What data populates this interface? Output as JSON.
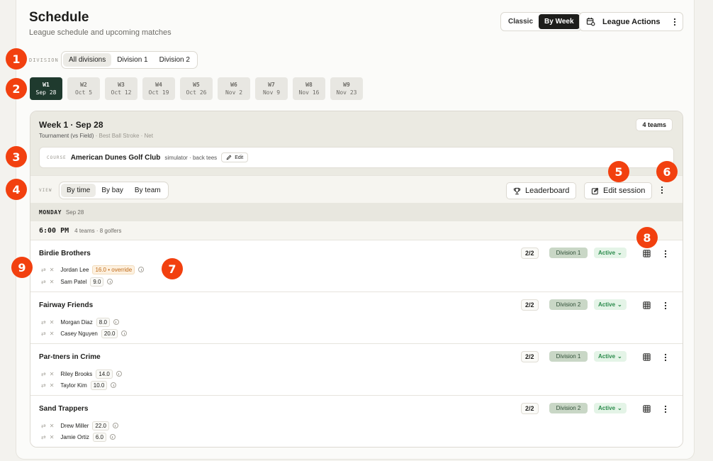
{
  "header": {
    "title": "Schedule",
    "subtitle": "League schedule and upcoming matches",
    "mode_toggle": {
      "classic": "Classic",
      "by_week": "By Week",
      "selected": "By Week"
    },
    "league_actions": "League Actions"
  },
  "division": {
    "label": "DIVISION",
    "options": [
      "All divisions",
      "Division 1",
      "Division 2"
    ],
    "selected": "All divisions"
  },
  "weeks": [
    {
      "label": "W1",
      "date": "Sep 28",
      "selected": true
    },
    {
      "label": "W2",
      "date": "Oct 5"
    },
    {
      "label": "W3",
      "date": "Oct 12"
    },
    {
      "label": "W4",
      "date": "Oct 19"
    },
    {
      "label": "W5",
      "date": "Oct 26"
    },
    {
      "label": "W6",
      "date": "Nov 2"
    },
    {
      "label": "W7",
      "date": "Nov 9"
    },
    {
      "label": "W8",
      "date": "Nov 16"
    },
    {
      "label": "W9",
      "date": "Nov 23"
    }
  ],
  "week_panel": {
    "title": "Week 1 · Sep 28",
    "format": "Tournament (vs Field)",
    "format_detail": "· Best Ball Stroke · Net",
    "teams_count": "4 teams",
    "course": {
      "label": "COURSE",
      "name": "American Dunes Golf Club",
      "meta": "simulator · back tees",
      "edit_label": "Edit"
    },
    "view": {
      "label": "VIEW",
      "options": [
        "By time",
        "By bay",
        "By team"
      ],
      "selected": "By time"
    },
    "leaderboard_label": "Leaderboard",
    "edit_session_label": "Edit session",
    "day": {
      "name": "MONDAY",
      "date": "Sep 28"
    },
    "timeslot": {
      "time": "6:00 PM",
      "summary": "4 teams · 8 golfers"
    }
  },
  "teams": [
    {
      "name": "Birdie Brothers",
      "count": "2/2",
      "division": "Division 1",
      "status": "Active",
      "players": [
        {
          "name": "Jordan Lee",
          "handicap": "16.0 • override",
          "override": true
        },
        {
          "name": "Sam Patel",
          "handicap": "9.0"
        }
      ]
    },
    {
      "name": "Fairway Friends",
      "count": "2/2",
      "division": "Division 2",
      "status": "Active",
      "players": [
        {
          "name": "Morgan Diaz",
          "handicap": "8.0"
        },
        {
          "name": "Casey Nguyen",
          "handicap": "20.0"
        }
      ]
    },
    {
      "name": "Par-tners in Crime",
      "count": "2/2",
      "division": "Division 1",
      "status": "Active",
      "players": [
        {
          "name": "Riley Brooks",
          "handicap": "14.0"
        },
        {
          "name": "Taylor Kim",
          "handicap": "10.0"
        }
      ]
    },
    {
      "name": "Sand Trappers",
      "count": "2/2",
      "division": "Division 2",
      "status": "Active",
      "players": [
        {
          "name": "Drew Miller",
          "handicap": "22.0"
        },
        {
          "name": "Jamie Ortiz",
          "handicap": "6.0"
        }
      ]
    }
  ],
  "annotations": [
    "1",
    "2",
    "3",
    "4",
    "5",
    "6",
    "7",
    "8",
    "9"
  ],
  "icons": {
    "league_actions": "calendar-gear-icon",
    "more": "kebab-icon",
    "leaderboard": "trophy-icon",
    "edit": "pencil-icon",
    "swap": "swap-icon",
    "remove": "close-icon",
    "info": "info-icon",
    "grid": "grid-icon",
    "chevron": "chevron-down-icon"
  },
  "colors": {
    "accent_dark": "#1f3a2e",
    "active_green": "#2a8a4b",
    "override_orange": "#c06a18",
    "annotation_red": "#f2400f"
  }
}
